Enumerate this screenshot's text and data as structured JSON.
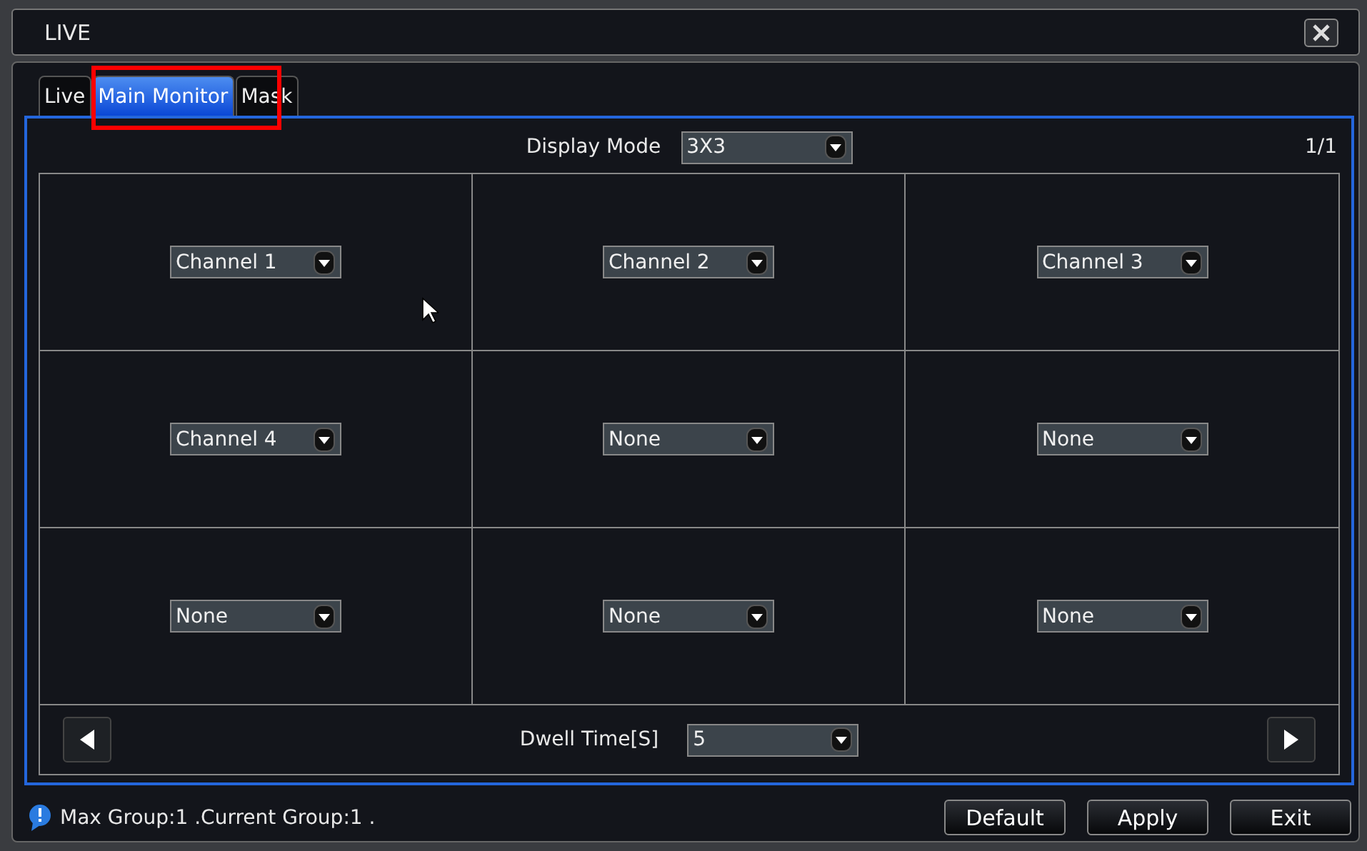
{
  "window": {
    "title": "LIVE"
  },
  "tabs": [
    {
      "label": "Live",
      "selected": false
    },
    {
      "label": "Main Monitor",
      "selected": true
    },
    {
      "label": "Mask",
      "selected": false
    }
  ],
  "display_mode": {
    "label": "Display Mode",
    "value": "3X3"
  },
  "page_indicator": "1/1",
  "cells": [
    {
      "value": "Channel 1"
    },
    {
      "value": "Channel 2"
    },
    {
      "value": "Channel 3"
    },
    {
      "value": "Channel 4"
    },
    {
      "value": "None"
    },
    {
      "value": "None"
    },
    {
      "value": "None"
    },
    {
      "value": "None"
    },
    {
      "value": "None"
    }
  ],
  "dwell_time": {
    "label": "Dwell Time[S]",
    "value": "5"
  },
  "status": "Max Group:1 .Current Group:1 .",
  "buttons": [
    "Default",
    "Apply",
    "Exit"
  ]
}
